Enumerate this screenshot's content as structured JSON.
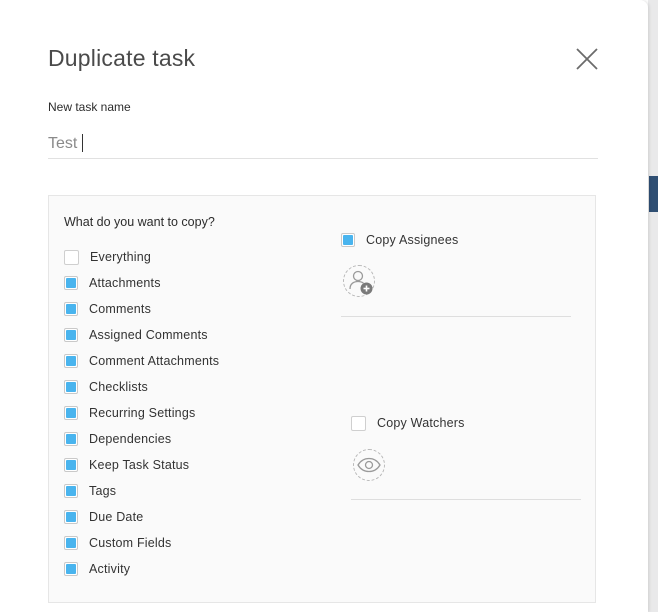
{
  "dialog": {
    "title": "Duplicate task",
    "field_label": "New task name",
    "task_name_value": "Test",
    "question": "What do you want to copy?"
  },
  "options": [
    {
      "label": "Everything",
      "checked": false
    },
    {
      "label": "Attachments",
      "checked": true
    },
    {
      "label": "Comments",
      "checked": true
    },
    {
      "label": "Assigned Comments",
      "checked": true
    },
    {
      "label": "Comment Attachments",
      "checked": true
    },
    {
      "label": "Checklists",
      "checked": true
    },
    {
      "label": "Recurring Settings",
      "checked": true
    },
    {
      "label": "Dependencies",
      "checked": true
    },
    {
      "label": "Keep Task Status",
      "checked": true
    },
    {
      "label": "Tags",
      "checked": true
    },
    {
      "label": "Due Date",
      "checked": true
    },
    {
      "label": "Custom Fields",
      "checked": true
    },
    {
      "label": "Activity",
      "checked": true
    }
  ],
  "copy_assignees": {
    "label": "Copy Assignees",
    "checked": true,
    "icon": "add-user-icon"
  },
  "copy_watchers": {
    "label": "Copy Watchers",
    "checked": false,
    "icon": "eye-icon"
  },
  "colors": {
    "accent": "#49b4ee",
    "panel_bg": "#fafafa",
    "backdrop_accent": "#2f4f73"
  }
}
